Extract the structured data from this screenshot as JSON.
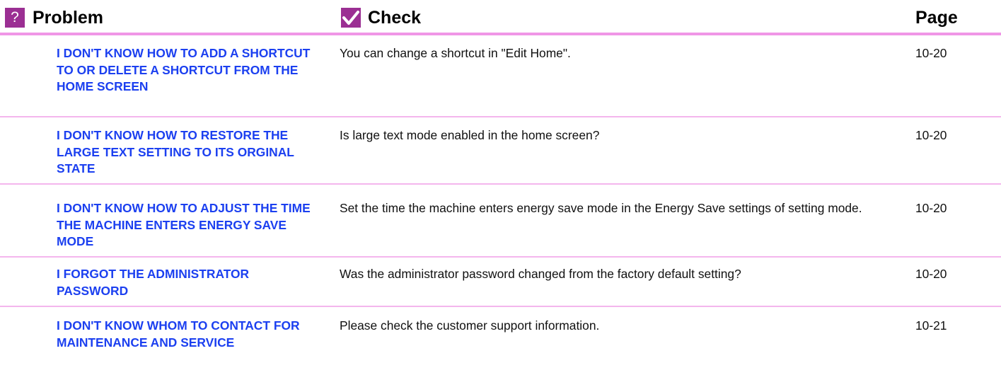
{
  "header": {
    "problem_label": "Problem",
    "check_label": "Check",
    "page_label": "Page",
    "problem_icon": "question-mark-icon",
    "check_icon": "checkmark-icon",
    "accent_color": "#9b2f93",
    "rule_color": "#f096e6",
    "link_color": "#1c40f0"
  },
  "rows": [
    {
      "problem": "I DON'T KNOW HOW TO ADD A SHORTCUT TO OR DELETE A SHORTCUT FROM THE HOME SCREEN",
      "check": "You can change a shortcut in \"Edit Home\".",
      "page": "10-20"
    },
    {
      "problem": "I DON'T KNOW HOW TO RESTORE THE LARGE TEXT SETTING TO ITS ORGINAL STATE",
      "check": "Is large text mode enabled in the home screen?",
      "page": "10-20"
    },
    {
      "problem": "I DON'T KNOW HOW TO ADJUST THE TIME THE MACHINE ENTERS ENERGY SAVE MODE",
      "check": "Set the time the machine enters energy save mode in the Energy Save settings of setting mode.",
      "page": "10-20"
    },
    {
      "problem": "I FORGOT THE ADMINISTRATOR PASSWORD",
      "check": "Was the administrator password changed from the factory default setting?",
      "page": "10-20"
    },
    {
      "problem": "I DON'T KNOW WHOM TO CONTACT FOR MAINTENANCE AND SERVICE",
      "check": "Please check the customer support information.",
      "page": "10-21"
    }
  ]
}
